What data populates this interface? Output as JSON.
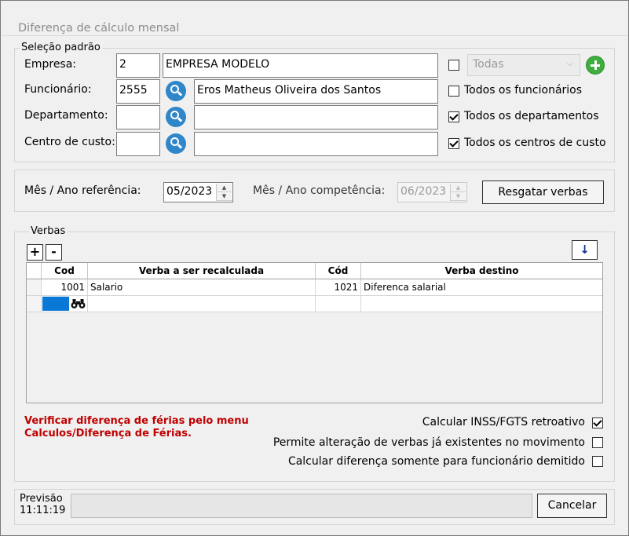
{
  "window": {
    "title": "Diferença de cálculo mensal"
  },
  "selecao": {
    "legend": "Seleção padrão",
    "empresa": {
      "label": "Empresa:",
      "code": "2",
      "name": "EMPRESA MODELO"
    },
    "funcionario": {
      "label": "Funcionário:",
      "code": "2555",
      "name": "Eros Matheus Oliveira dos Santos"
    },
    "departamento": {
      "label": "Departamento:",
      "code": "",
      "name": ""
    },
    "centro": {
      "label": "Centro de custo:",
      "code": "",
      "name": ""
    },
    "todas_combo": {
      "value": "Todas",
      "checked": false
    },
    "checks": {
      "todos_funcionarios": {
        "label": "Todos os funcionários",
        "checked": false
      },
      "todos_departamentos": {
        "label": "Todos os departamentos",
        "checked": true
      },
      "todos_centros": {
        "label": "Todos os centros de custo",
        "checked": true
      }
    }
  },
  "periodo": {
    "ref_label": "Mês / Ano referência:",
    "ref_value": "05/2023",
    "comp_label": "Mês / Ano competência:",
    "comp_value": "06/2023",
    "resgatar_label": "Resgatar verbas"
  },
  "verbas": {
    "legend": "Verbas",
    "add_label": "+",
    "remove_label": "-",
    "down_label": "↓",
    "columns": [
      "Cod",
      "Verba a ser recalculada",
      "Cód",
      "Verba destino"
    ],
    "rows": [
      {
        "cod": "1001",
        "verba": "Salario",
        "cod_destino": "1021",
        "verba_destino": "Diferenca salarial"
      }
    ]
  },
  "warning": {
    "line1": "Verificar diferença de férias pelo menu",
    "line2": "Calculos/Diferença de Férias."
  },
  "options": {
    "inss": {
      "label": "Calcular INSS/FGTS retroativo",
      "checked": true
    },
    "permite": {
      "label": "Permite alteração de verbas já existentes no movimento",
      "checked": false
    },
    "demitido": {
      "label": "Calcular diferença somente para funcionário demitido",
      "checked": false
    }
  },
  "footer": {
    "previsao_label": "Previsão",
    "previsao_time": "11:11:19",
    "progress": 0,
    "cancelar_label": "Cancelar"
  },
  "colors": {
    "accent_blue": "#2f86c9",
    "add_green": "#3fae3f",
    "warning_red": "#c00000",
    "selected_cell": "#0a78d7"
  }
}
